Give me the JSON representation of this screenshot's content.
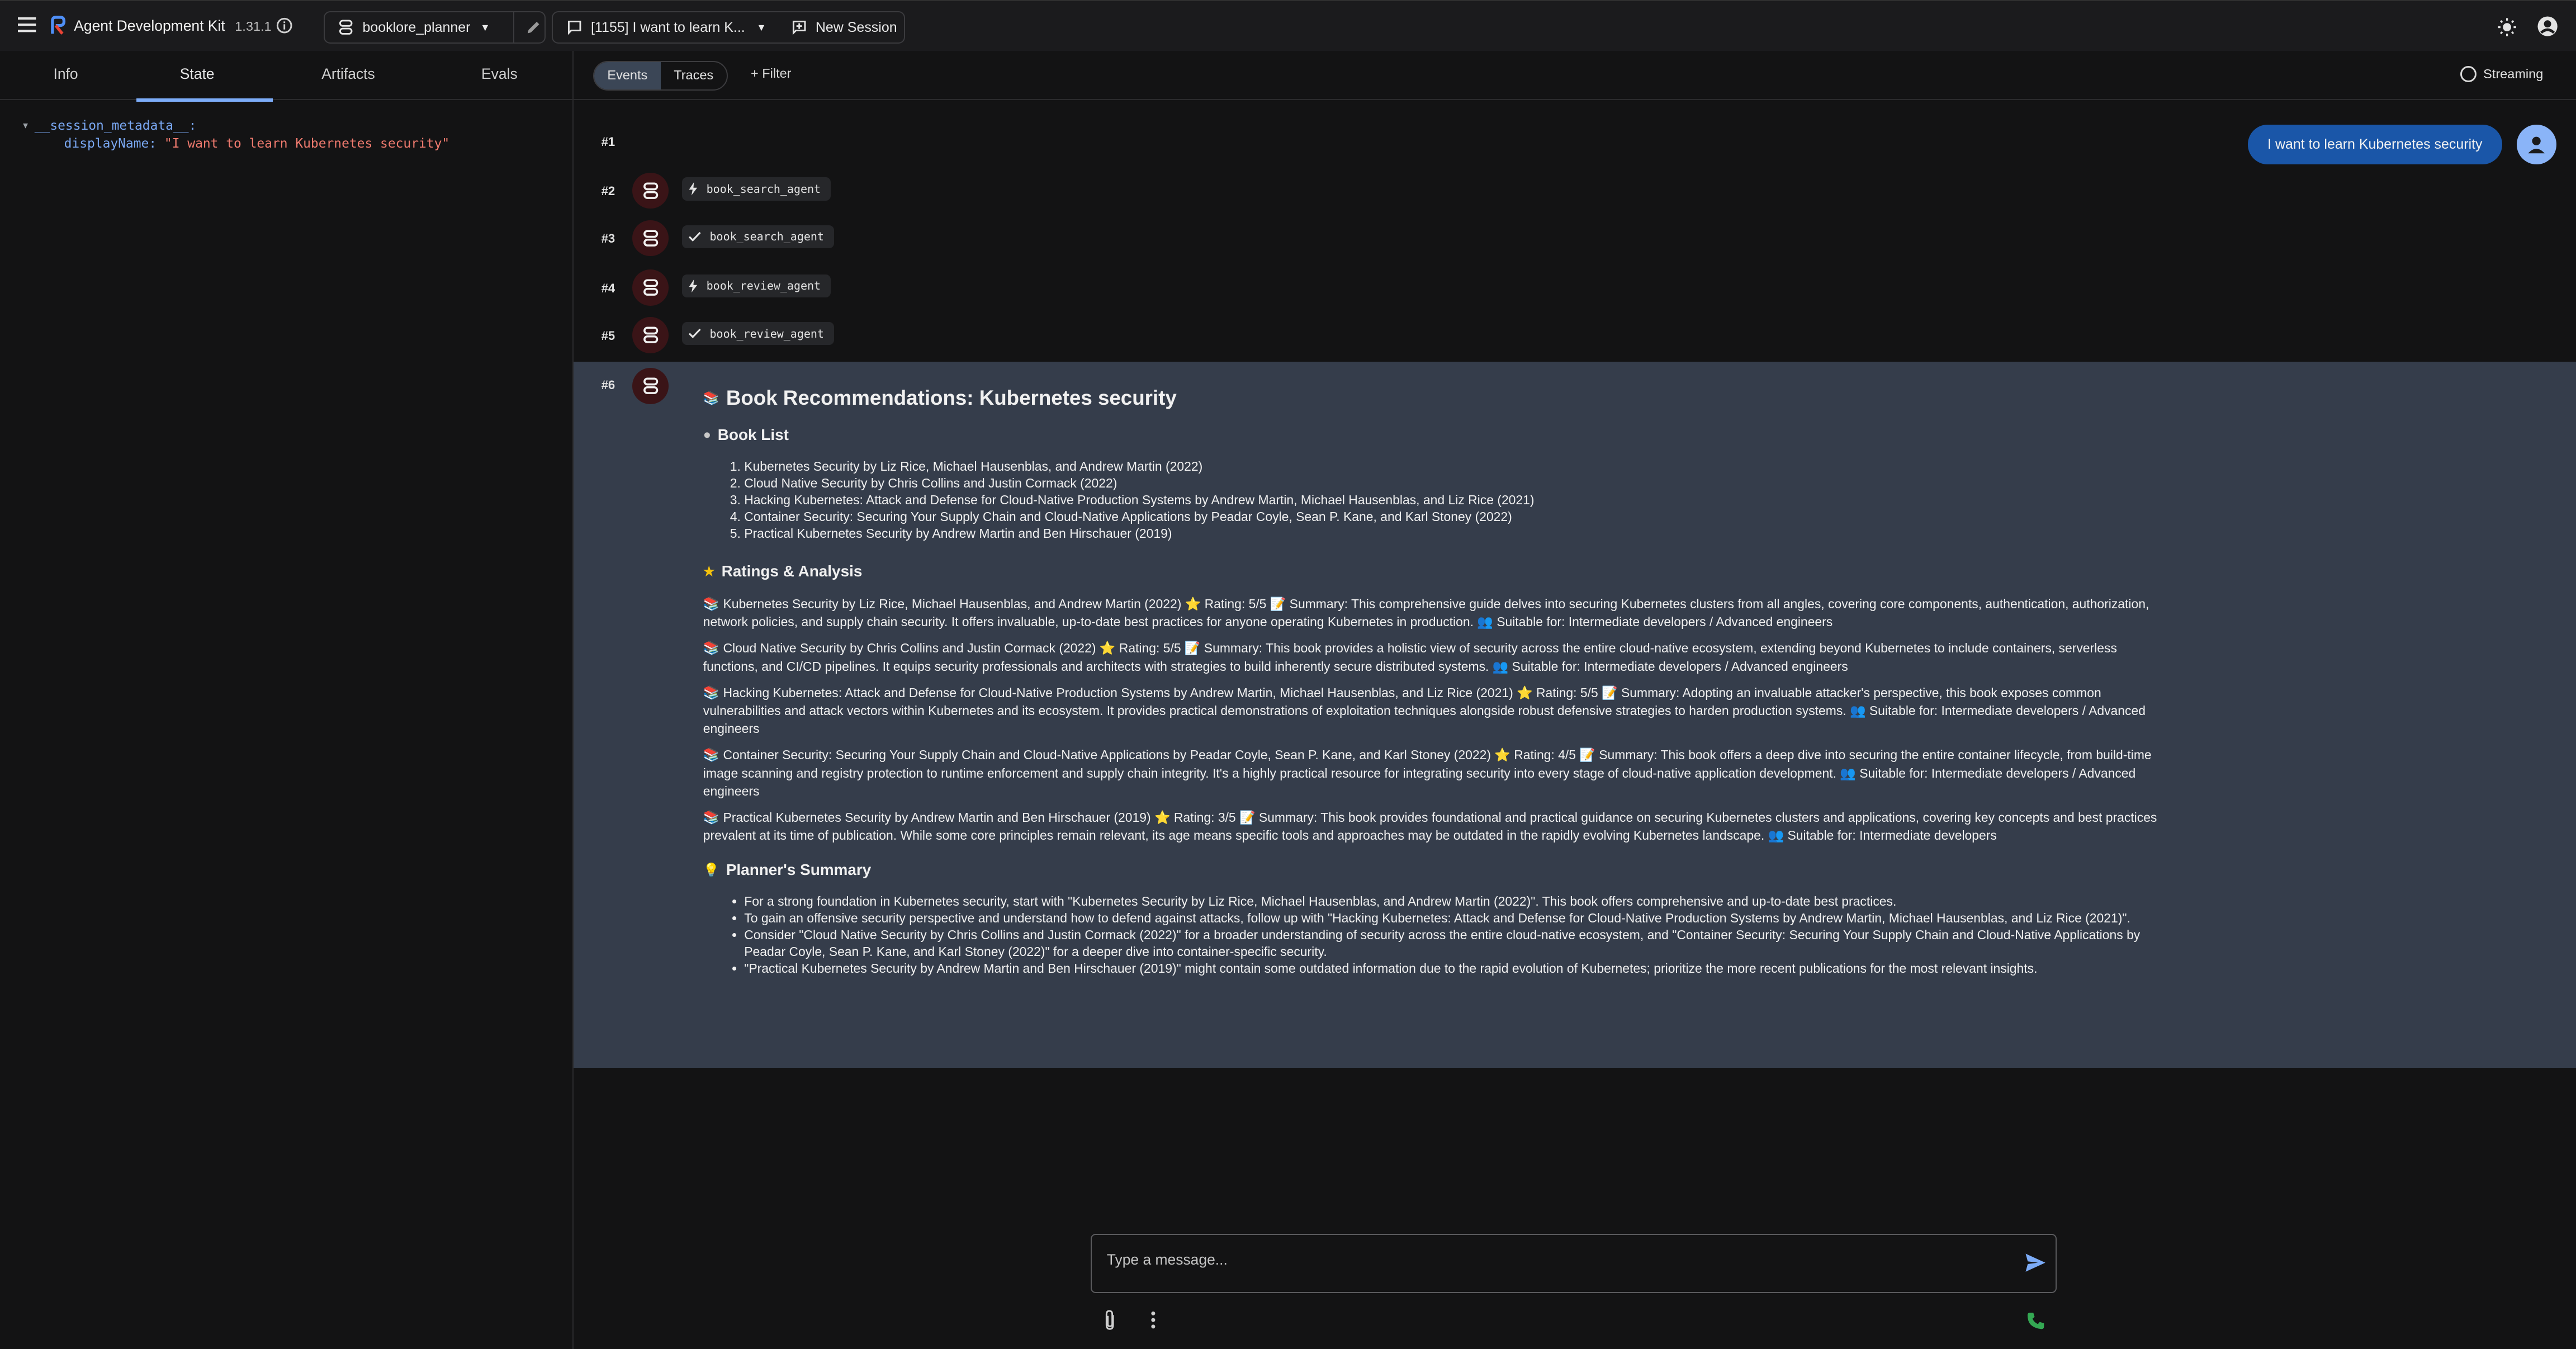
{
  "app": {
    "title": "Agent Development Kit",
    "version": "1.31.1",
    "agent_selector": "booklore_planner",
    "session_selector": "[1155] I want to learn K...",
    "new_session": "New Session"
  },
  "left_tabs": [
    "Info",
    "State",
    "Artifacts",
    "Evals"
  ],
  "active_tab": "State",
  "state": {
    "root_key": "__session_metadata__:",
    "child_key": "displayName:",
    "child_value": "\"I want to learn Kubernetes security\""
  },
  "events_bar": {
    "events": "Events",
    "traces": "Traces",
    "filter": "+ Filter",
    "streaming": "Streaming"
  },
  "events": [
    {
      "num": "#1"
    },
    {
      "num": "#2",
      "kind": "call",
      "label": "book_search_agent"
    },
    {
      "num": "#3",
      "kind": "done",
      "label": "book_search_agent"
    },
    {
      "num": "#4",
      "kind": "call",
      "label": "book_review_agent"
    },
    {
      "num": "#5",
      "kind": "done",
      "label": "book_review_agent"
    },
    {
      "num": "#6"
    }
  ],
  "user_message": "I want to learn Kubernetes security",
  "response": {
    "title": "Book Recommendations: Kubernetes security",
    "book_list_heading": "Book List",
    "book_list": [
      "Kubernetes Security by Liz Rice, Michael Hausenblas, and Andrew Martin (2022)",
      "Cloud Native Security by Chris Collins and Justin Cormack (2022)",
      "Hacking Kubernetes: Attack and Defense for Cloud-Native Production Systems by Andrew Martin, Michael Hausenblas, and Liz Rice (2021)",
      "Container Security: Securing Your Supply Chain and Cloud-Native Applications by Peadar Coyle, Sean P. Kane, and Karl Stoney (2022)",
      "Practical Kubernetes Security by Andrew Martin and Ben Hirschauer (2019)"
    ],
    "ratings_heading": "Ratings & Analysis",
    "ratings": [
      "Kubernetes Security by Liz Rice, Michael Hausenblas, and Andrew Martin (2022) ⭐ Rating: 5/5 📝 Summary: This comprehensive guide delves into securing Kubernetes clusters from all angles, covering core components, authentication, authorization, network policies, and supply chain security. It offers invaluable, up-to-date best practices for anyone operating Kubernetes in production. 👥 Suitable for: Intermediate developers / Advanced engineers",
      "Cloud Native Security by Chris Collins and Justin Cormack (2022) ⭐ Rating: 5/5 📝 Summary: This book provides a holistic view of security across the entire cloud-native ecosystem, extending beyond Kubernetes to include containers, serverless functions, and CI/CD pipelines. It equips security professionals and architects with strategies to build inherently secure distributed systems. 👥 Suitable for: Intermediate developers / Advanced engineers",
      "Hacking Kubernetes: Attack and Defense for Cloud-Native Production Systems by Andrew Martin, Michael Hausenblas, and Liz Rice (2021) ⭐ Rating: 5/5 📝 Summary: Adopting an invaluable attacker's perspective, this book exposes common vulnerabilities and attack vectors within Kubernetes and its ecosystem. It provides practical demonstrations of exploitation techniques alongside robust defensive strategies to harden production systems. 👥 Suitable for: Intermediate developers / Advanced engineers",
      "Container Security: Securing Your Supply Chain and Cloud-Native Applications by Peadar Coyle, Sean P. Kane, and Karl Stoney (2022) ⭐ Rating: 4/5 📝 Summary: This book offers a deep dive into securing the entire container lifecycle, from build-time image scanning and registry protection to runtime enforcement and supply chain integrity. It's a highly practical resource for integrating security into every stage of cloud-native application development. 👥 Suitable for: Intermediate developers / Advanced engineers",
      "Practical Kubernetes Security by Andrew Martin and Ben Hirschauer (2019) ⭐ Rating: 3/5 📝 Summary: This book provides foundational and practical guidance on securing Kubernetes clusters and applications, covering key concepts and best practices prevalent at its time of publication. While some core principles remain relevant, its age means specific tools and approaches may be outdated in the rapidly evolving Kubernetes landscape. 👥 Suitable for: Intermediate developers"
    ],
    "summary_heading": "Planner's Summary",
    "summary": [
      "For a strong foundation in Kubernetes security, start with \"Kubernetes Security by Liz Rice, Michael Hausenblas, and Andrew Martin (2022)\". This book offers comprehensive and up-to-date best practices.",
      "To gain an offensive security perspective and understand how to defend against attacks, follow up with \"Hacking Kubernetes: Attack and Defense for Cloud-Native Production Systems by Andrew Martin, Michael Hausenblas, and Liz Rice (2021)\".",
      "Consider \"Cloud Native Security by Chris Collins and Justin Cormack (2022)\" for a broader understanding of security across the entire cloud-native ecosystem, and \"Container Security: Securing Your Supply Chain and Cloud-Native Applications by Peadar Coyle, Sean P. Kane, and Karl Stoney (2022)\" for a deeper dive into container-specific security.",
      "\"Practical Kubernetes Security by Andrew Martin and Ben Hirschauer (2019)\" might contain some outdated information due to the rapid evolution of Kubernetes; prioritize the more recent publications for the most relevant insights."
    ]
  },
  "composer": {
    "placeholder": "Type a message..."
  },
  "colors": {
    "background": "#131314",
    "accent": "#7cacf8",
    "user_bubble": "#1a56a8",
    "message_highlight": "#353d4b",
    "agent_avatar": "#3a1417",
    "state_string": "#f07b6f",
    "call_icon_green": "#34a853"
  },
  "icons": [
    "menu-icon",
    "adk-logo-icon",
    "info-icon",
    "agent-icon",
    "edit-icon",
    "chat-icon",
    "new-session-icon",
    "sun-icon",
    "account-icon",
    "bolt-icon",
    "check-icon",
    "books-icon",
    "send-icon",
    "attach-icon",
    "more-icon",
    "phone-icon"
  ]
}
